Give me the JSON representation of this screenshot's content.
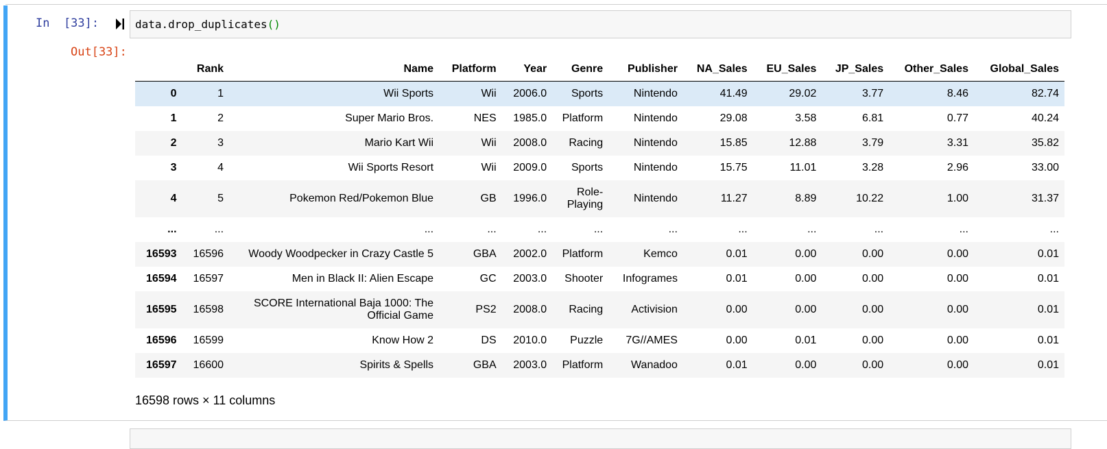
{
  "input_cell": {
    "prompt": "In  [33]:",
    "code_text": "data.drop_duplicates",
    "code_parens": "()"
  },
  "output_cell": {
    "prompt": "Out[33]:",
    "columns": [
      "",
      "Rank",
      "Name",
      "Platform",
      "Year",
      "Genre",
      "Publisher",
      "NA_Sales",
      "EU_Sales",
      "JP_Sales",
      "Other_Sales",
      "Global_Sales"
    ],
    "rows": [
      {
        "index": "0",
        "rank": "1",
        "name": "Wii Sports",
        "platform": "Wii",
        "year": "2006.0",
        "genre": "Sports",
        "publisher": "Nintendo",
        "na": "41.49",
        "eu": "29.02",
        "jp": "3.77",
        "other": "8.46",
        "global": "82.74"
      },
      {
        "index": "1",
        "rank": "2",
        "name": "Super Mario Bros.",
        "platform": "NES",
        "year": "1985.0",
        "genre": "Platform",
        "publisher": "Nintendo",
        "na": "29.08",
        "eu": "3.58",
        "jp": "6.81",
        "other": "0.77",
        "global": "40.24"
      },
      {
        "index": "2",
        "rank": "3",
        "name": "Mario Kart Wii",
        "platform": "Wii",
        "year": "2008.0",
        "genre": "Racing",
        "publisher": "Nintendo",
        "na": "15.85",
        "eu": "12.88",
        "jp": "3.79",
        "other": "3.31",
        "global": "35.82"
      },
      {
        "index": "3",
        "rank": "4",
        "name": "Wii Sports Resort",
        "platform": "Wii",
        "year": "2009.0",
        "genre": "Sports",
        "publisher": "Nintendo",
        "na": "15.75",
        "eu": "11.01",
        "jp": "3.28",
        "other": "2.96",
        "global": "33.00"
      },
      {
        "index": "4",
        "rank": "5",
        "name": "Pokemon Red/Pokemon Blue",
        "platform": "GB",
        "year": "1996.0",
        "genre": "Role-Playing",
        "publisher": "Nintendo",
        "na": "11.27",
        "eu": "8.89",
        "jp": "10.22",
        "other": "1.00",
        "global": "31.37"
      },
      {
        "index": "...",
        "rank": "...",
        "name": "...",
        "platform": "...",
        "year": "...",
        "genre": "...",
        "publisher": "...",
        "na": "...",
        "eu": "...",
        "jp": "...",
        "other": "...",
        "global": "..."
      },
      {
        "index": "16593",
        "rank": "16596",
        "name": "Woody Woodpecker in Crazy Castle 5",
        "platform": "GBA",
        "year": "2002.0",
        "genre": "Platform",
        "publisher": "Kemco",
        "na": "0.01",
        "eu": "0.00",
        "jp": "0.00",
        "other": "0.00",
        "global": "0.01"
      },
      {
        "index": "16594",
        "rank": "16597",
        "name": "Men in Black II: Alien Escape",
        "platform": "GC",
        "year": "2003.0",
        "genre": "Shooter",
        "publisher": "Infogrames",
        "na": "0.01",
        "eu": "0.00",
        "jp": "0.00",
        "other": "0.00",
        "global": "0.01"
      },
      {
        "index": "16595",
        "rank": "16598",
        "name": "SCORE International Baja 1000: The Official Game",
        "platform": "PS2",
        "year": "2008.0",
        "genre": "Racing",
        "publisher": "Activision",
        "na": "0.00",
        "eu": "0.00",
        "jp": "0.00",
        "other": "0.00",
        "global": "0.01"
      },
      {
        "index": "16596",
        "rank": "16599",
        "name": "Know How 2",
        "platform": "DS",
        "year": "2010.0",
        "genre": "Puzzle",
        "publisher": "7G//AMES",
        "na": "0.00",
        "eu": "0.01",
        "jp": "0.00",
        "other": "0.00",
        "global": "0.01"
      },
      {
        "index": "16597",
        "rank": "16600",
        "name": "Spirits & Spells",
        "platform": "GBA",
        "year": "2003.0",
        "genre": "Platform",
        "publisher": "Wanadoo",
        "na": "0.01",
        "eu": "0.00",
        "jp": "0.00",
        "other": "0.00",
        "global": "0.01"
      }
    ],
    "shape_text": "16598 rows × 11 columns"
  },
  "colors": {
    "cell_border": "#42a5f5",
    "in_prompt": "#303f9f",
    "out_prompt": "#d84315",
    "row_highlight": "#dbeaf7"
  },
  "icons": {
    "run": "run-cell-icon"
  }
}
